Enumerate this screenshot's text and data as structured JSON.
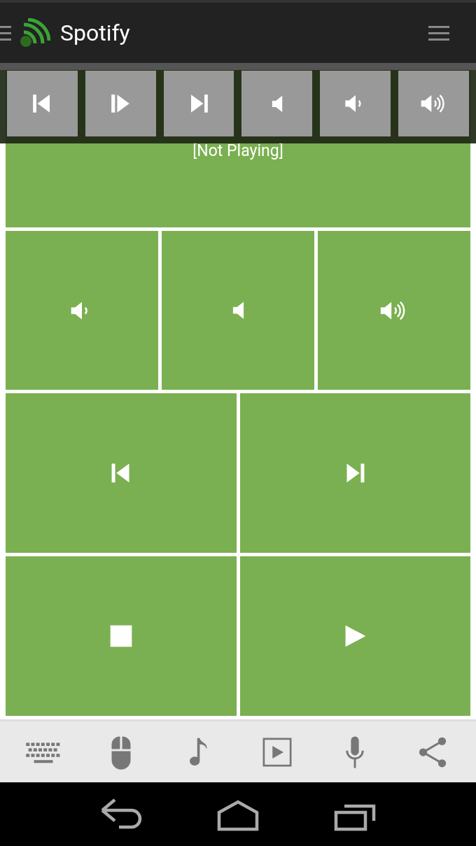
{
  "app_bar": {
    "title": "Spotify"
  },
  "toolbar": [
    {
      "kind": "previous"
    },
    {
      "kind": "play-pause"
    },
    {
      "kind": "next"
    },
    {
      "kind": "mute"
    },
    {
      "kind": "volume-down"
    },
    {
      "kind": "volume-up"
    }
  ],
  "now_playing": {
    "text": "[Not Playing]"
  },
  "tile_rows": [
    [
      {
        "kind": "volume-down"
      },
      {
        "kind": "mute"
      },
      {
        "kind": "volume-up"
      }
    ],
    [
      {
        "kind": "previous"
      },
      {
        "kind": "next"
      }
    ],
    [
      {
        "kind": "stop"
      },
      {
        "kind": "play"
      }
    ]
  ],
  "bottom_bar": [
    {
      "kind": "keyboard"
    },
    {
      "kind": "mouse"
    },
    {
      "kind": "music"
    },
    {
      "kind": "media"
    },
    {
      "kind": "mic"
    },
    {
      "kind": "share"
    }
  ],
  "nav_bar": [
    {
      "kind": "back"
    },
    {
      "kind": "home"
    },
    {
      "kind": "recents"
    }
  ]
}
